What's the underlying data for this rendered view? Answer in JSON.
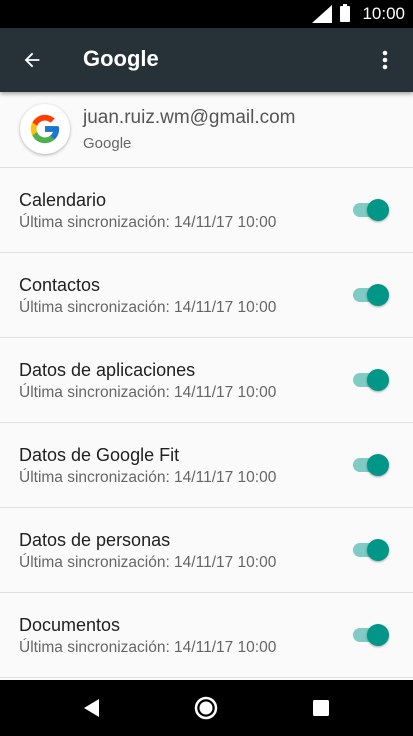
{
  "status_bar": {
    "time": "10:00",
    "signal_icon": "signal-icon",
    "battery_icon": "battery-icon"
  },
  "app_bar": {
    "title": "Google",
    "back_icon": "arrow-back-icon",
    "overflow_icon": "more-vert-icon"
  },
  "account": {
    "email": "juan.ruiz.wm@gmail.com",
    "type": "Google",
    "logo_icon": "google-logo-icon"
  },
  "sync_items": [
    {
      "label": "Calendario",
      "status": "Última sincronización: 14/11/17 10:00",
      "enabled": true
    },
    {
      "label": "Contactos",
      "status": "Última sincronización: 14/11/17 10:00",
      "enabled": true
    },
    {
      "label": "Datos de aplicaciones",
      "status": "Última sincronización: 14/11/17 10:00",
      "enabled": true
    },
    {
      "label": "Datos de Google Fit",
      "status": "Última sincronización: 14/11/17 10:00",
      "enabled": true
    },
    {
      "label": "Datos de personas",
      "status": "Última sincronización: 14/11/17 10:00",
      "enabled": true
    },
    {
      "label": "Documentos",
      "status": "Última sincronización: 14/11/17 10:00",
      "enabled": true
    }
  ],
  "nav_bar": {
    "back_icon": "nav-back-icon",
    "home_icon": "nav-home-icon",
    "recents_icon": "nav-recents-icon"
  },
  "colors": {
    "app_bar": "#263238",
    "toggle_thumb": "#009688",
    "toggle_track": "#80cbc4"
  }
}
